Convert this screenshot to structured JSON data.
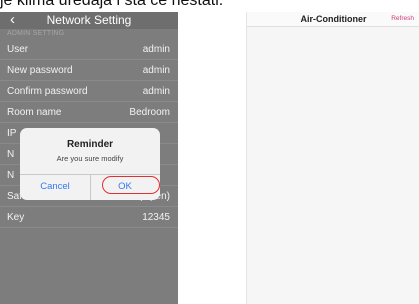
{
  "caption": "je klima uredaja i sta ce nestati.",
  "left_screen": {
    "title": "Network Setting",
    "back_icon": "‹",
    "section_header": "ADMIN SETTING",
    "rows": [
      {
        "label": "User",
        "value": "admin"
      },
      {
        "label": "New password",
        "value": "admin"
      },
      {
        "label": "Confirm password",
        "value": "admin"
      },
      {
        "label": "Room name",
        "value": "Bedroom"
      },
      {
        "label": "IP",
        "value": ""
      },
      {
        "label": "N",
        "value": ""
      },
      {
        "label": "N",
        "value": ""
      },
      {
        "label": "Safe mode",
        "value": "WEP64(Open)"
      },
      {
        "label": "Key",
        "value": "12345"
      }
    ],
    "dialog": {
      "title": "Reminder",
      "message": "Are you sure modify",
      "cancel": "Cancel",
      "ok": "OK"
    }
  },
  "right_screen": {
    "title": "Air-Conditioner",
    "refresh": "Refresh"
  },
  "colors": {
    "highlight": "#e03030",
    "dialog_button": "#3478f6",
    "refresh": "#d33b7a"
  }
}
